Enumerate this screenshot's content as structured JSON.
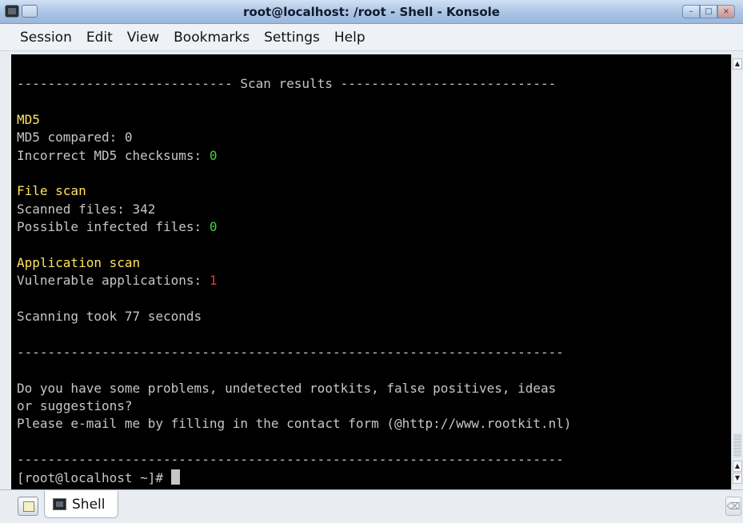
{
  "window": {
    "title": "root@localhost: /root - Shell - Konsole"
  },
  "menu": [
    "Session",
    "Edit",
    "View",
    "Bookmarks",
    "Settings",
    "Help"
  ],
  "terminal": {
    "lines": [
      {
        "segments": [
          {
            "text": "---------------------------- Scan results ----------------------------",
            "color": "gray"
          }
        ]
      },
      {
        "segments": [
          {
            "text": "",
            "color": "gray"
          }
        ]
      },
      {
        "segments": [
          {
            "text": "MD5",
            "color": "yellow"
          }
        ]
      },
      {
        "segments": [
          {
            "text": "MD5 compared: 0",
            "color": "gray"
          }
        ]
      },
      {
        "segments": [
          {
            "text": "Incorrect MD5 checksums: ",
            "color": "gray"
          },
          {
            "text": "0",
            "color": "green"
          }
        ]
      },
      {
        "segments": [
          {
            "text": "",
            "color": "gray"
          }
        ]
      },
      {
        "segments": [
          {
            "text": "File scan",
            "color": "yellow"
          }
        ]
      },
      {
        "segments": [
          {
            "text": "Scanned files: 342",
            "color": "gray"
          }
        ]
      },
      {
        "segments": [
          {
            "text": "Possible infected files: ",
            "color": "gray"
          },
          {
            "text": "0",
            "color": "green"
          }
        ]
      },
      {
        "segments": [
          {
            "text": "",
            "color": "gray"
          }
        ]
      },
      {
        "segments": [
          {
            "text": "Application scan",
            "color": "yellow"
          }
        ]
      },
      {
        "segments": [
          {
            "text": "Vulnerable applications: ",
            "color": "gray"
          },
          {
            "text": "1",
            "color": "red"
          }
        ]
      },
      {
        "segments": [
          {
            "text": "",
            "color": "gray"
          }
        ]
      },
      {
        "segments": [
          {
            "text": "Scanning took 77 seconds",
            "color": "gray"
          }
        ]
      },
      {
        "segments": [
          {
            "text": "",
            "color": "gray"
          }
        ]
      },
      {
        "segments": [
          {
            "text": "-----------------------------------------------------------------------",
            "color": "gray"
          }
        ]
      },
      {
        "segments": [
          {
            "text": "",
            "color": "gray"
          }
        ]
      },
      {
        "segments": [
          {
            "text": "Do you have some problems, undetected rootkits, false positives, ideas",
            "color": "gray"
          }
        ]
      },
      {
        "segments": [
          {
            "text": "or suggestions?",
            "color": "gray"
          }
        ]
      },
      {
        "segments": [
          {
            "text": "Please e-mail me by filling in the contact form (@http://www.rootkit.nl)",
            "color": "gray"
          }
        ]
      },
      {
        "segments": [
          {
            "text": "",
            "color": "gray"
          }
        ]
      },
      {
        "segments": [
          {
            "text": "-----------------------------------------------------------------------",
            "color": "gray"
          }
        ]
      }
    ],
    "prompt": "[root@localhost ~]# "
  },
  "tabs": [
    {
      "label": "Shell",
      "icon": "terminal-icon",
      "active": true
    }
  ],
  "colors": {
    "yellow": "#ffe45c",
    "green": "#3cd63c",
    "red": "#e23b3b",
    "gray": "#c6c6c6",
    "background": "#000000"
  }
}
